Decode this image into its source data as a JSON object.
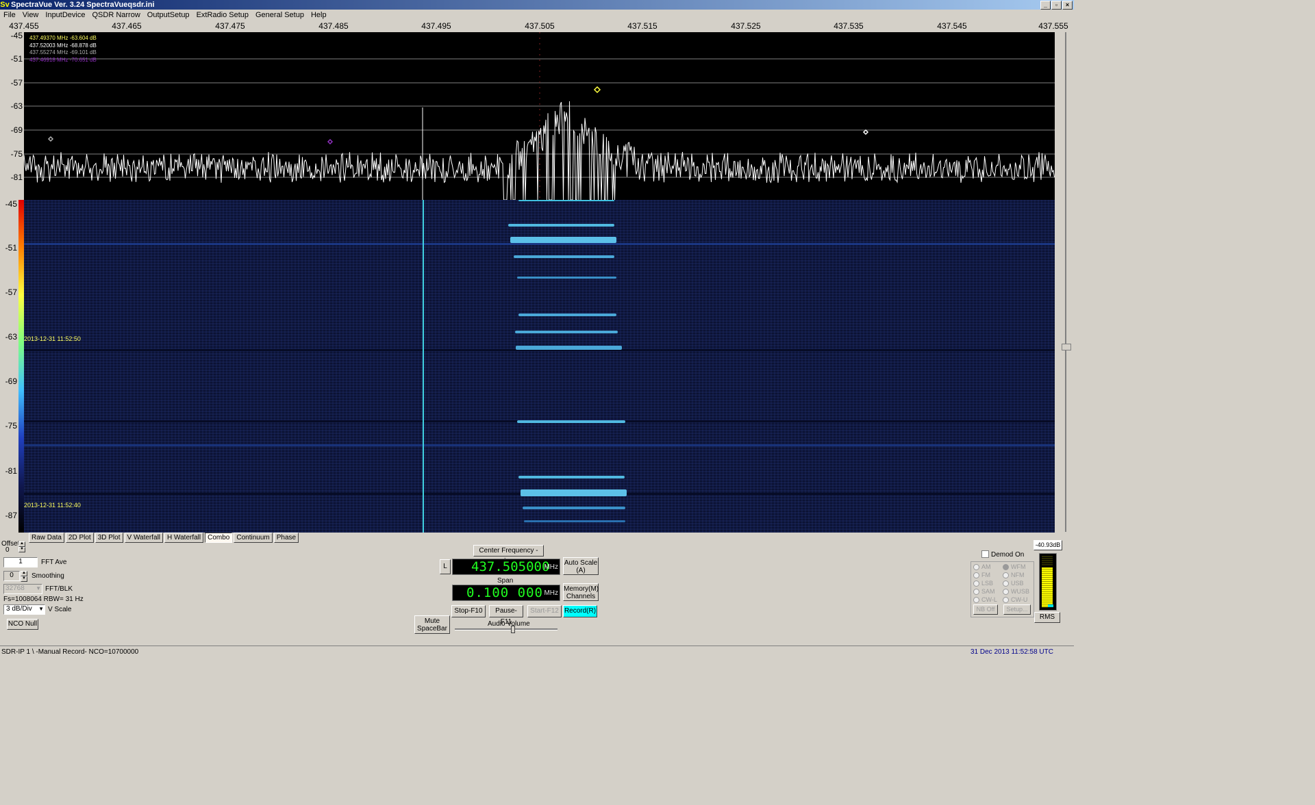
{
  "window": {
    "title": "SpectraVue Ver. 3.24  SpectraVueqsdr.ini",
    "icon": "Sv"
  },
  "menu": [
    "File",
    "View",
    "InputDevice",
    "QSDR Narrow",
    "OutputSetup",
    "ExtRadio Setup",
    "General Setup",
    "Help"
  ],
  "freq_axis": [
    "437.455",
    "437.465",
    "437.475",
    "437.485",
    "437.495",
    "437.505",
    "437.515",
    "437.525",
    "437.535",
    "437.545",
    "437.555"
  ],
  "spectrum_y_axis": [
    "-45",
    "-51",
    "-57",
    "-63",
    "-69",
    "-75",
    "-81"
  ],
  "waterfall_y_axis": [
    "-45",
    "-51",
    "-57",
    "-63",
    "-69",
    "-75",
    "-81",
    "-87"
  ],
  "markers": [
    {
      "text": "437.49370 MHz -63.604 dB",
      "color": "#ffff60"
    },
    {
      "text": "437.52003 MHz -68.878 dB",
      "color": "#ffffff"
    },
    {
      "text": "437.55274 MHz -69.101 dB",
      "color": "#b0b0b0"
    },
    {
      "text": "437.46918 MHz -70.651 dB",
      "color": "#9030c0"
    }
  ],
  "waterfall": {
    "time_top": "2013-12-31 11:52:50",
    "time_bottom": "2013-12-31 11:52:40"
  },
  "tabs": [
    "Raw Data",
    "2D Plot",
    "3D Plot",
    "V Waterfall",
    "H Waterfall",
    "Combo",
    "Continuum",
    "Phase"
  ],
  "active_tab": "Combo",
  "left_controls": {
    "offset_label": "Offset",
    "offset_value": "0",
    "fft_ave_value": "1",
    "fft_ave_label": "FFT Ave",
    "smoothing_value": "0",
    "smoothing_label": "Smoothing",
    "fft_blk_value": "32768",
    "fft_blk_label": "FFT/BLK",
    "fs_text": "Fs=1008064 RBW=  31 Hz",
    "vscale_value": "3 dB/Div",
    "vscale_label": "V Scale",
    "nco_null": "NCO Null"
  },
  "center": {
    "center_freq_button": "Center Frequency - Ins",
    "l_button": "L",
    "freq_display": "437.505000",
    "freq_unit": "MHz",
    "auto_scale": "Auto Scale (A)",
    "span_label": "Span",
    "span_display": "0.100 000",
    "span_unit": "MHz",
    "memory": "Memory(M) Channels",
    "stop": "Stop-F10",
    "pause": "Pause-F11",
    "start": "Start-F12",
    "record": "Record(R)",
    "mute": "Mute SpaceBar",
    "audio_volume": "Audio Volume"
  },
  "demod": {
    "demod_on": "Demod On",
    "modes_left": [
      "AM",
      "FM",
      "LSB",
      "SAM",
      "CW-L"
    ],
    "modes_right": [
      "WFM",
      "NFM",
      "USB",
      "WUSB",
      "CW-U"
    ],
    "nb_off": "NB Off",
    "setup": "Setup...",
    "level": "-40.93dB",
    "rms": "RMS"
  },
  "status": {
    "left": "SDR-IP 1  \\ -Manual Record-   NCO=10700000",
    "right": "31 Dec 2013  11:52:58 UTC"
  }
}
